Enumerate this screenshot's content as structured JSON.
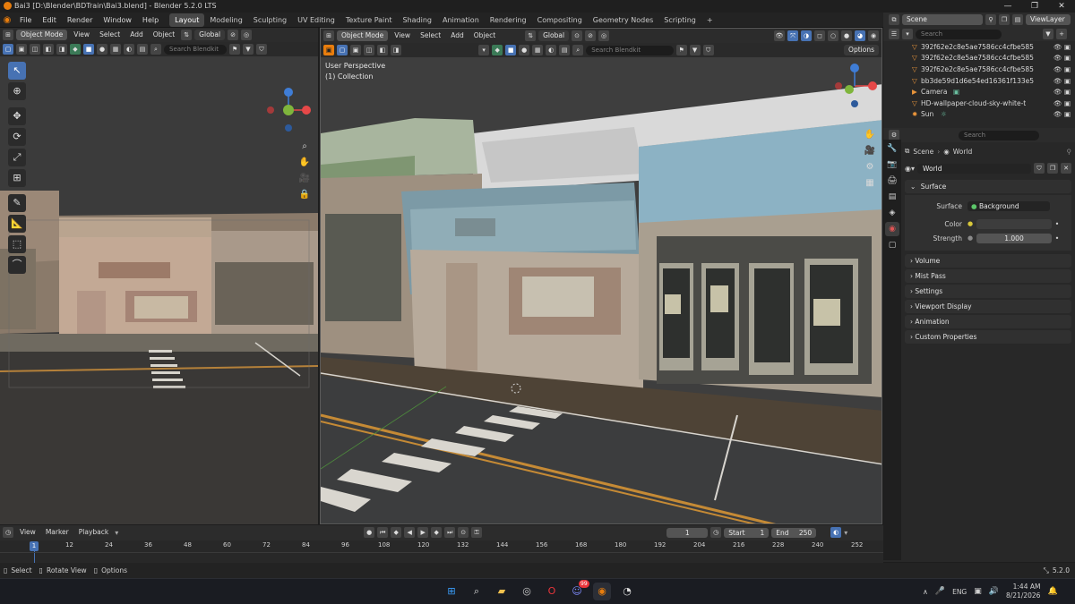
{
  "window": {
    "title": "Bai3 [D:\\Blender\\BDTrain\\Bai3.blend] - Blender 5.2.0 LTS"
  },
  "menu": [
    "File",
    "Edit",
    "Render",
    "Window",
    "Help"
  ],
  "workspaces": [
    "Layout",
    "Modeling",
    "Sculpting",
    "UV Editing",
    "Texture Paint",
    "Shading",
    "Animation",
    "Rendering",
    "Compositing",
    "Geometry Nodes",
    "Scripting"
  ],
  "active_workspace": "Layout",
  "scene": {
    "scene_name": "Scene",
    "view_layer": "ViewLayer"
  },
  "viewport_left": {
    "mode": "Object Mode",
    "menus": [
      "View",
      "Select",
      "Add",
      "Object"
    ],
    "transform": "Global",
    "search_placeholder": "Search Blendkit"
  },
  "viewport_right": {
    "mode": "Object Mode",
    "menus": [
      "View",
      "Select",
      "Add",
      "Object"
    ],
    "transform": "Global",
    "search_placeholder": "Search Blendkit",
    "options_label": "Options",
    "overlay_title": "User Perspective",
    "overlay_collection": "(1) Collection"
  },
  "outliner": {
    "search_placeholder": "Search",
    "items": [
      {
        "name": "392f62e2c8e5ae7586cc4cfbe585",
        "icon": "mesh"
      },
      {
        "name": "392f62e2c8e5ae7586cc4cfbe585",
        "icon": "mesh"
      },
      {
        "name": "392f62e2c8e5ae7586cc4cfbe585",
        "icon": "mesh"
      },
      {
        "name": "bb3de59d1d6e54ed16361f133e5",
        "icon": "mesh"
      },
      {
        "name": "Camera",
        "icon": "camera"
      },
      {
        "name": "HD-wallpaper-cloud-sky-white-t",
        "icon": "mesh"
      },
      {
        "name": "Sun",
        "icon": "light"
      }
    ]
  },
  "properties": {
    "search_placeholder": "Search",
    "breadcrumb_scene": "Scene",
    "breadcrumb_world": "World",
    "world_name": "World",
    "surface_label": "Surface",
    "surface_field_label": "Surface",
    "surface_value": "Background",
    "color_label": "Color",
    "strength_label": "Strength",
    "strength_value": "1.000",
    "panels": [
      "Volume",
      "Mist Pass",
      "Settings",
      "Viewport Display",
      "Animation",
      "Custom Properties"
    ]
  },
  "timeline": {
    "menus": [
      "View",
      "Marker",
      "Playback"
    ],
    "current_frame": "1",
    "start_label": "Start",
    "start_value": "1",
    "end_label": "End",
    "end_value": "250",
    "frame_marker": "1",
    "ticks": [
      "12",
      "24",
      "36",
      "48",
      "60",
      "72",
      "84",
      "96",
      "108",
      "120",
      "132",
      "144",
      "156",
      "168",
      "180",
      "192",
      "204",
      "216",
      "228",
      "240",
      "252"
    ]
  },
  "status": {
    "select": "Select",
    "rotate": "Rotate View",
    "options": "Options",
    "version": "5.2.0"
  },
  "taskbar": {
    "lang": "ENG",
    "time": "1:44 AM",
    "date": "8/21/2026",
    "badge": "99"
  },
  "colors": {
    "accent": "#4772b3",
    "axis_x": "#e64848",
    "axis_y": "#7fb53c",
    "axis_z": "#3f7dd6",
    "scene_bg": "#3d3d3d"
  }
}
